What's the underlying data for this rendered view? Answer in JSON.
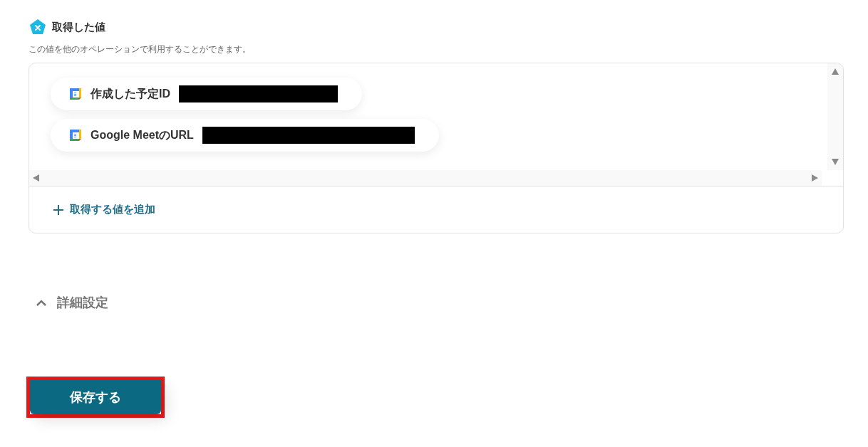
{
  "section": {
    "title": "取得した値",
    "description": "この値を他のオペレーションで利用することができます。"
  },
  "values": [
    {
      "label": "作成した予定ID",
      "redacted": true
    },
    {
      "label": "Google MeetのURL",
      "redacted": true
    }
  ],
  "add_link": {
    "label": "取得する値を追加"
  },
  "advanced": {
    "label": "詳細設定",
    "expanded": true
  },
  "save_button": {
    "label": "保存する",
    "highlighted": true
  }
}
